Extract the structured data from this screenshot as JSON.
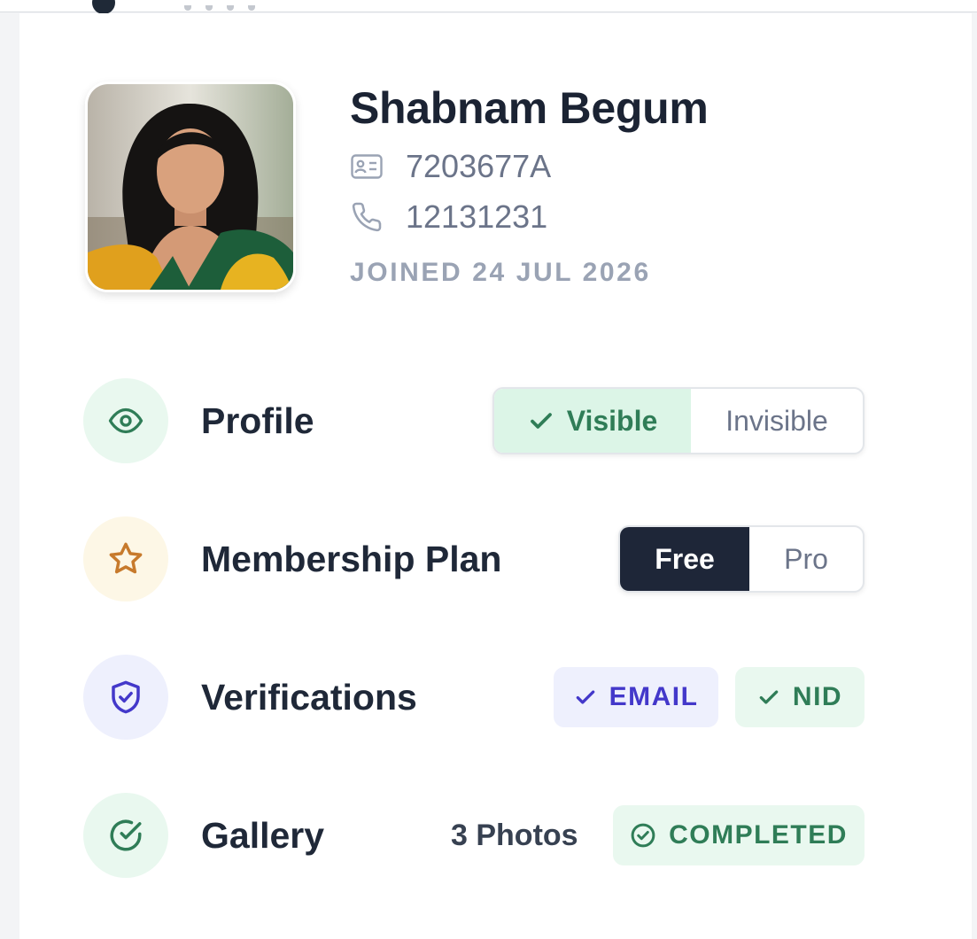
{
  "profile": {
    "name": "Shabnam Begum",
    "id_number": "7203677A",
    "phone": "12131231",
    "joined": "JOINED 24 JUL 2026"
  },
  "rows": {
    "profile": {
      "label": "Profile",
      "icon": "eye-icon",
      "options": [
        "Visible",
        "Invisible"
      ],
      "selected": "Visible"
    },
    "membership": {
      "label": "Membership Plan",
      "icon": "star-icon",
      "options": [
        "Free",
        "Pro"
      ],
      "selected": "Free"
    },
    "verifications": {
      "label": "Verifications",
      "icon": "shield-check-icon",
      "badges": [
        "EMAIL",
        "NID"
      ]
    },
    "gallery": {
      "label": "Gallery",
      "icon": "check-circle-icon",
      "count_text": "3 Photos",
      "status": "COMPLETED"
    }
  },
  "colors": {
    "green_text": "#2f7d57",
    "green_bg": "#dcf5e7",
    "indigo_text": "#4338ca",
    "indigo_bg": "#eef0fd",
    "amber_icon": "#c77a2c",
    "amber_bg": "#fdf7e6",
    "dark_selected": "#1e2638"
  }
}
